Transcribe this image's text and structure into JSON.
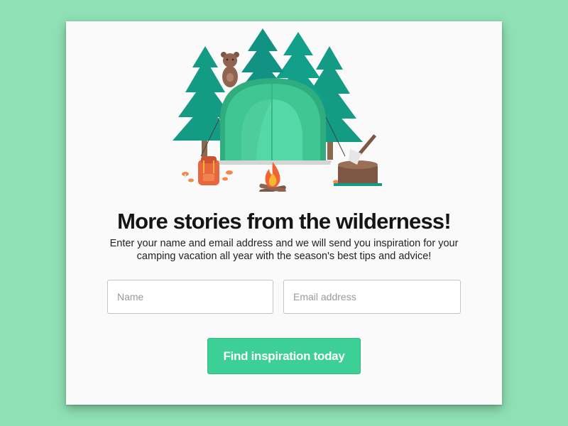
{
  "signup": {
    "title": "More stories from the wilderness!",
    "description": "Enter your name and email address and we will send you inspiration for your camping vacation all year with the season's best tips and advice!",
    "name_placeholder": "Name",
    "email_placeholder": "Email address",
    "submit_label": "Find inspiration today"
  },
  "colors": {
    "background": "#8fe0b5",
    "card": "#fafafa",
    "accent": "#3ccf96",
    "tree": "#139b84",
    "tent": "#3fc692"
  },
  "icons": [
    "pine-tree-icon",
    "tent-icon",
    "bear-icon",
    "backpack-icon",
    "campfire-icon",
    "axe-icon",
    "tree-stump-icon",
    "mushroom-icon"
  ]
}
